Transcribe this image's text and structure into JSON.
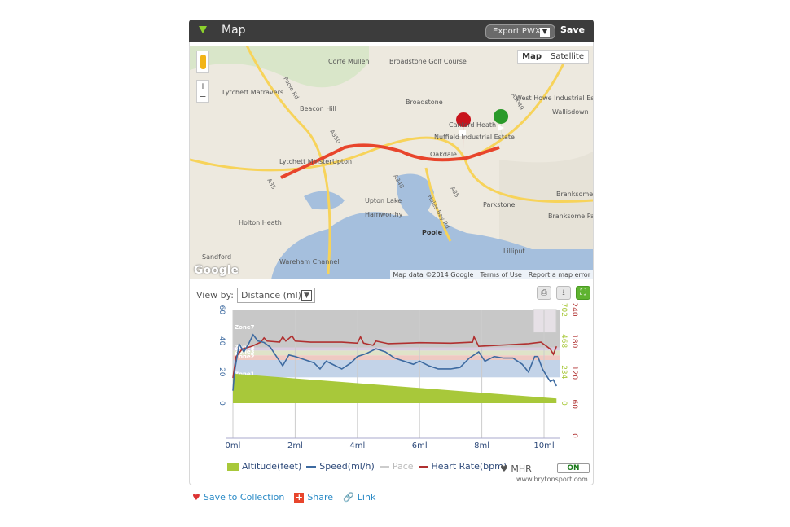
{
  "header": {
    "title": "Map",
    "export_label": "Export PWX",
    "save_label": "Save"
  },
  "map": {
    "type_buttons": [
      "Map",
      "Satellite"
    ],
    "zoom_in": "+",
    "zoom_out": "−",
    "google_logo": "Google",
    "attribution": [
      "Map data ©2014 Google",
      "Terms of Use",
      "Report a map error"
    ],
    "labels": [
      "Corfe Mullen",
      "Broadstone Golf Course",
      "Lytchett Matravers",
      "Beacon Hill",
      "Broadstone",
      "West Howe Industrial Estate",
      "Wallisdown",
      "Canford Heath",
      "Nuffield Industrial Estate",
      "Lytchett Minster",
      "Upton",
      "Oakdale",
      "Parkstone",
      "Branksome",
      "Holton Heath",
      "Upton Lake",
      "Hamworthy",
      "Branksome Park",
      "Poole",
      "Sandford",
      "Wareham Channel",
      "Lilliput"
    ],
    "road_labels": [
      "Poole Rd",
      "A350",
      "A35",
      "A3049",
      "A35",
      "Holes Bay Rd",
      "A348"
    ],
    "colors": {
      "route": "#e8452c",
      "water": "#a5bfdd",
      "land": "#ede9df",
      "road": "#f7d35a"
    }
  },
  "chart": {
    "view_by_label": "View by:",
    "view_by_value": "Distance (ml)",
    "toolbar_icons": [
      "print-icon",
      "download-icon",
      "fullscreen-icon"
    ],
    "mhr_label": "MHR",
    "toggle_label": "ON",
    "site": "www.brytonsport.com"
  },
  "chart_data": {
    "type": "line",
    "x_unit": "ml",
    "xlim": [
      0,
      10.5
    ],
    "x_ticks": [
      "0ml",
      "2ml",
      "4ml",
      "6ml",
      "8ml",
      "10ml"
    ],
    "left_ticks": [
      "0",
      "20",
      "40",
      "60"
    ],
    "pace_ticks": [
      "0",
      "234",
      "468",
      "702"
    ],
    "hr_ticks": [
      "0",
      "60",
      "120",
      "180",
      "240"
    ],
    "ylim_speed": [
      -20,
      60
    ],
    "ylim_hr": [
      0,
      240
    ],
    "zones": [
      {
        "name": "Zone7",
        "hr": [
          168,
          240
        ],
        "color": "#c8c8c8"
      },
      {
        "name": "Zone4",
        "hr": [
          162,
          168
        ],
        "color": "#d8cde0"
      },
      {
        "name": "Zone3",
        "hr": [
          153,
          162
        ],
        "color": "#dfe3c8"
      },
      {
        "name": "Zone2",
        "hr": [
          144,
          153
        ],
        "color": "#efc9c2"
      },
      {
        "name": "Zone1",
        "hr": [
          111,
          144
        ],
        "color": "#c3d3e8"
      }
    ],
    "series": [
      {
        "name": "Altitude(feet)",
        "color": "#a8c83a",
        "points": [
          [
            0,
            19
          ],
          [
            10.4,
            3
          ]
        ]
      },
      {
        "name": "Speed(ml/h)",
        "color": "#3d6aa0",
        "points": [
          [
            0,
            8
          ],
          [
            0.05,
            20
          ],
          [
            0.2,
            38
          ],
          [
            0.35,
            33
          ],
          [
            0.5,
            38
          ],
          [
            0.65,
            44
          ],
          [
            0.8,
            40
          ],
          [
            1.0,
            39
          ],
          [
            1.2,
            36
          ],
          [
            1.4,
            30
          ],
          [
            1.6,
            24
          ],
          [
            1.8,
            31
          ],
          [
            2.0,
            30
          ],
          [
            2.3,
            28
          ],
          [
            2.6,
            26
          ],
          [
            2.8,
            22
          ],
          [
            3.0,
            27
          ],
          [
            3.2,
            25
          ],
          [
            3.5,
            22
          ],
          [
            3.8,
            26
          ],
          [
            4.0,
            30
          ],
          [
            4.3,
            32
          ],
          [
            4.6,
            35
          ],
          [
            4.9,
            33
          ],
          [
            5.2,
            29
          ],
          [
            5.5,
            27
          ],
          [
            5.8,
            25
          ],
          [
            6.0,
            27
          ],
          [
            6.3,
            24
          ],
          [
            6.6,
            22
          ],
          [
            7.0,
            22
          ],
          [
            7.3,
            23
          ],
          [
            7.6,
            29
          ],
          [
            7.9,
            33
          ],
          [
            8.1,
            27
          ],
          [
            8.4,
            30
          ],
          [
            8.7,
            29
          ],
          [
            9.0,
            29
          ],
          [
            9.3,
            25
          ],
          [
            9.5,
            20
          ],
          [
            9.7,
            30
          ],
          [
            9.8,
            30
          ],
          [
            9.95,
            22
          ],
          [
            10.1,
            17
          ],
          [
            10.2,
            14
          ],
          [
            10.3,
            15
          ],
          [
            10.4,
            11
          ]
        ]
      },
      {
        "name": "Pace",
        "color": "#cccccc",
        "points": []
      },
      {
        "name": "Heart Rate(bpm)",
        "color": "#b03030",
        "points": [
          [
            0,
            110
          ],
          [
            0.1,
            150
          ],
          [
            0.3,
            165
          ],
          [
            0.6,
            170
          ],
          [
            0.9,
            178
          ],
          [
            1.0,
            186
          ],
          [
            1.1,
            180
          ],
          [
            1.5,
            178
          ],
          [
            1.6,
            188
          ],
          [
            1.7,
            180
          ],
          [
            1.9,
            190
          ],
          [
            2.0,
            180
          ],
          [
            2.5,
            178
          ],
          [
            3.5,
            178
          ],
          [
            4.0,
            176
          ],
          [
            4.1,
            188
          ],
          [
            4.2,
            176
          ],
          [
            4.5,
            172
          ],
          [
            4.6,
            180
          ],
          [
            5,
            175
          ],
          [
            6,
            177
          ],
          [
            7,
            176
          ],
          [
            7.7,
            178
          ],
          [
            7.75,
            188
          ],
          [
            7.9,
            170
          ],
          [
            8.5,
            172
          ],
          [
            9.5,
            175
          ],
          [
            9.9,
            178
          ],
          [
            10.2,
            165
          ],
          [
            10.3,
            155
          ],
          [
            10.4,
            170
          ]
        ]
      }
    ]
  },
  "actions": [
    "Save to Collection",
    "Share",
    "Link"
  ]
}
